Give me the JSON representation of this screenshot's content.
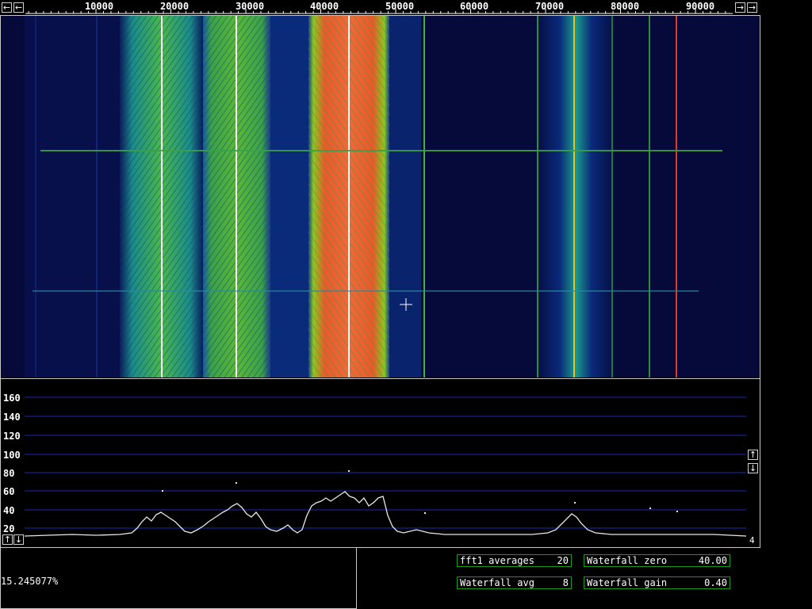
{
  "frequency_scale": {
    "ticks": [
      "10000",
      "20000",
      "30000",
      "40000",
      "50000",
      "60000",
      "70000",
      "80000",
      "90000"
    ]
  },
  "spectrum": {
    "db_ticks": [
      "160",
      "140",
      "120",
      "100",
      "80",
      "60",
      "40",
      "20"
    ],
    "right_marker": "4"
  },
  "status": {
    "readout": "15.245077%"
  },
  "params": {
    "fft1_averages_label": "fft1 averages",
    "fft1_averages_value": "20",
    "waterfall_avg_label": "Waterfall avg",
    "waterfall_avg_value": "8",
    "waterfall_zero_label": "Waterfall zero",
    "waterfall_zero_value": "40.00",
    "waterfall_gain_label": "Waterfall gain",
    "waterfall_gain_value": "0.40"
  },
  "icons": {
    "left_arrow": "←",
    "right_arrow": "→",
    "up_arrow": "↑",
    "down_arrow": "↓"
  },
  "colors": {
    "frame": "#c8c8c8",
    "grid": "#1a2ab8",
    "param_border": "#1a9a1a"
  }
}
